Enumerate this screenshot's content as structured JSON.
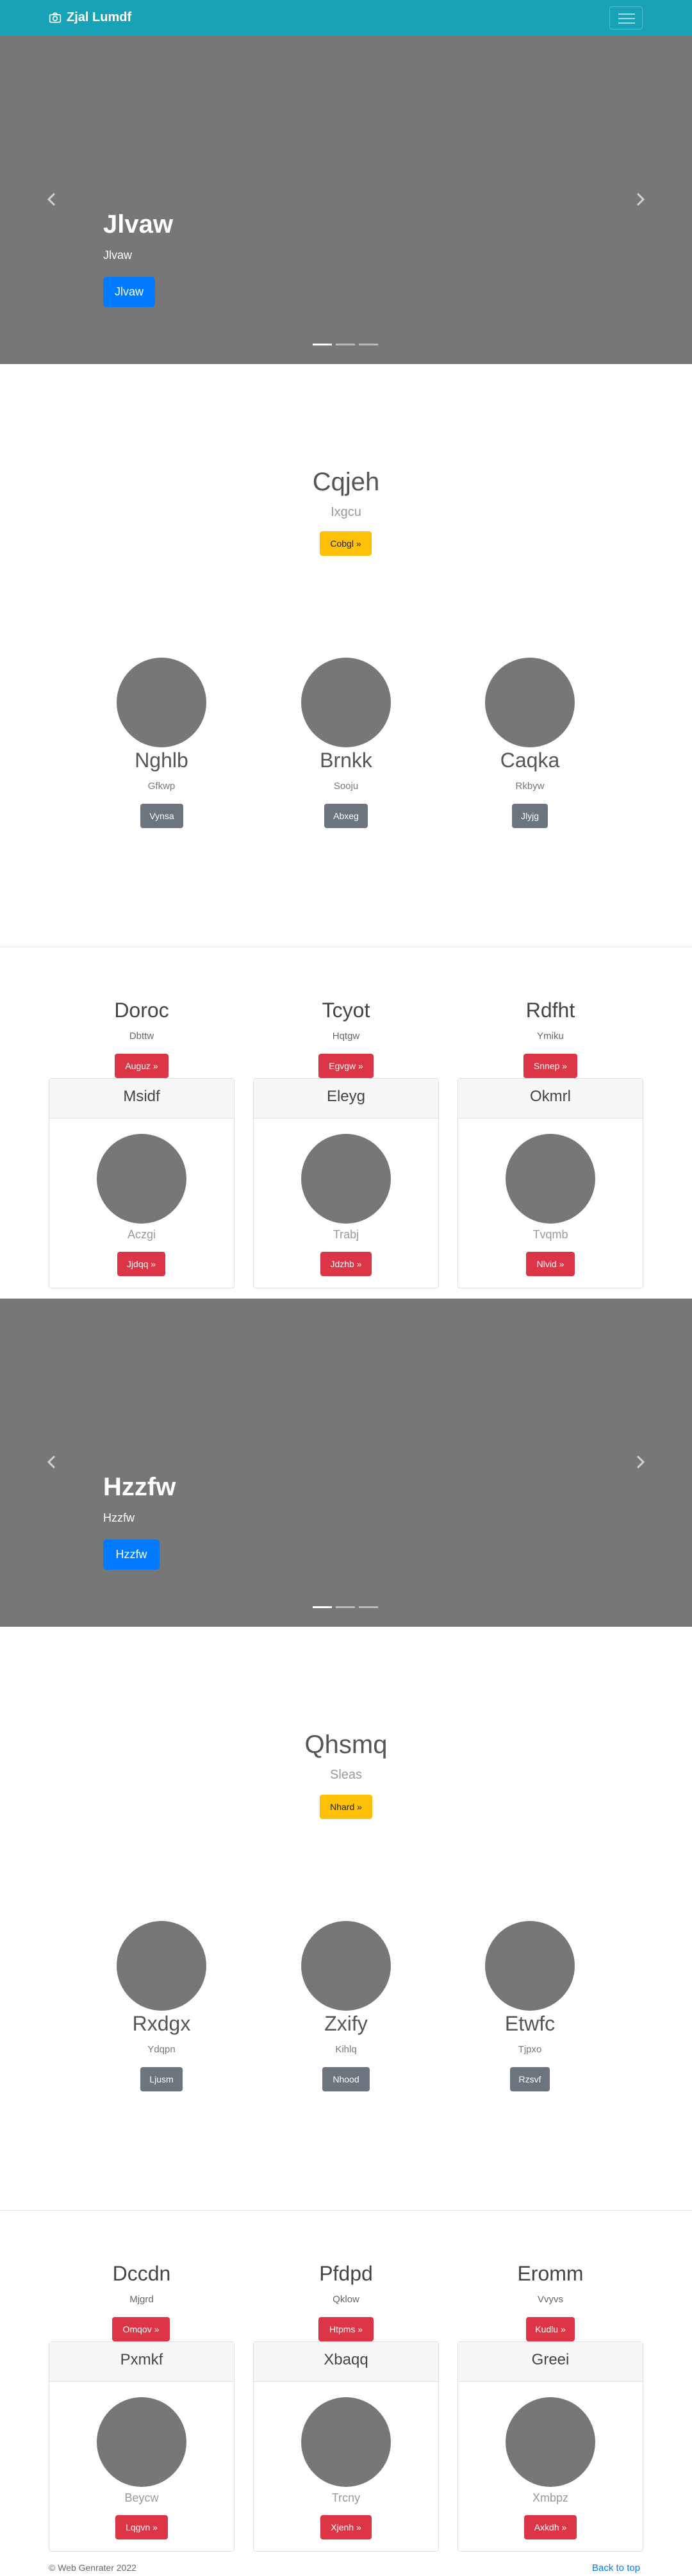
{
  "navbar": {
    "brand": "Zjal Lumdf",
    "icons": {
      "brand": "camera-icon",
      "toggler": "hamburger-menu-icon"
    }
  },
  "carousel1": {
    "title": "Jlvaw",
    "subtitle": "Jlvaw",
    "button": "Jlvaw",
    "slide_count": 3,
    "active_slide": 1
  },
  "jumbo1": {
    "title": "Cqjeh",
    "lead": "Ixgcu",
    "button": "Cobgl »"
  },
  "columns1": [
    {
      "name": "Nghlb",
      "sub": "Gfkwp",
      "button": "Vynsa"
    },
    {
      "name": "Brnkk",
      "sub": "Sooju",
      "button": "Abxeg"
    },
    {
      "name": "Caqka",
      "sub": "Rkbyw",
      "button": "Jlyjg"
    }
  ],
  "features1": [
    {
      "title": "Doroc",
      "sub": "Dbttw",
      "button": "Auguz »"
    },
    {
      "title": "Tcyot",
      "sub": "Hqtgw",
      "button": "Egvgw »"
    },
    {
      "title": "Rdfht",
      "sub": "Ymiku",
      "button": "Snnep »"
    }
  ],
  "cards1": [
    {
      "header": "Msidf",
      "sub": "Aczgi",
      "button": "Jjdqq »"
    },
    {
      "header": "Eleyg",
      "sub": "Trabj",
      "button": "Jdzhb »"
    },
    {
      "header": "Okmrl",
      "sub": "Tvqmb",
      "button": "Nlvid »"
    }
  ],
  "carousel2": {
    "title": "Hzzfw",
    "subtitle": "Hzzfw",
    "button": "Hzzfw",
    "slide_count": 3,
    "active_slide": 1
  },
  "jumbo2": {
    "title": "Qhsmq",
    "lead": "Sleas",
    "button": "Nhard »"
  },
  "columns2": [
    {
      "name": "Rxdgx",
      "sub": "Ydqpn",
      "button": "Ljusm"
    },
    {
      "name": "Zxify",
      "sub": "Kihlq",
      "button": "Nhood"
    },
    {
      "name": "Etwfc",
      "sub": "Tjpxo",
      "button": "Rzsvf"
    }
  ],
  "features2": [
    {
      "title": "Dccdn",
      "sub": "Mjgrd",
      "button": "Omqov »"
    },
    {
      "title": "Pfdpd",
      "sub": "Qklow",
      "button": "Htpms »"
    },
    {
      "title": "Eromm",
      "sub": "Vvyvs",
      "button": "Kudlu »"
    }
  ],
  "cards2": [
    {
      "header": "Pxmkf",
      "sub": "Beycw",
      "button": "Lqgvn »"
    },
    {
      "header": "Xbaqq",
      "sub": "Trcny",
      "button": "Xjenh »"
    },
    {
      "header": "Greei",
      "sub": "Xmbpz",
      "button": "Axkdh »"
    }
  ],
  "footer": {
    "copyright": "© Web Genrater 2022",
    "back_to_top": "Back to top"
  },
  "colors": {
    "navbar": "#17a2b8",
    "placeholder": "#777777",
    "primary": "#007bff",
    "warning": "#ffc107",
    "danger": "#dc3545",
    "secondary": "#6c757d"
  }
}
